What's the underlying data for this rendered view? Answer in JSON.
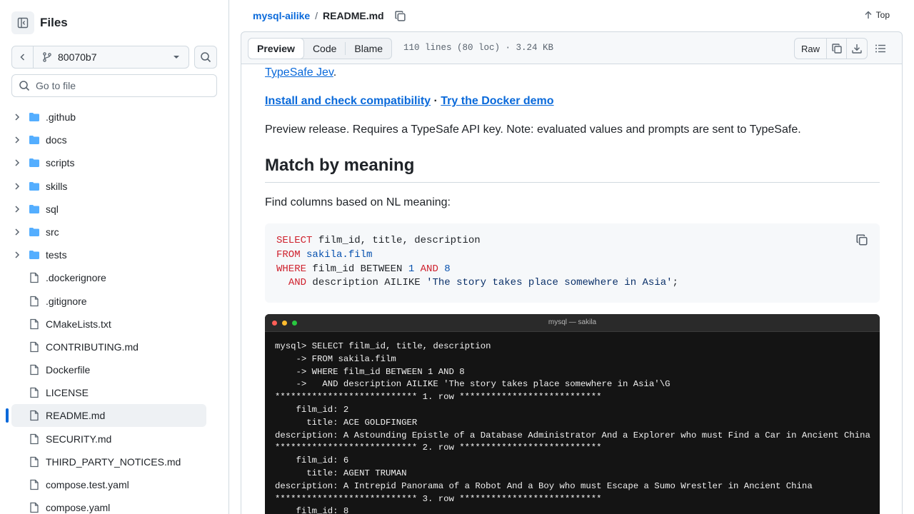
{
  "sidebar": {
    "title": "Files",
    "branch": "80070b7",
    "goto_placeholder": "Go to file",
    "items": [
      {
        "name": ".github",
        "type": "folder"
      },
      {
        "name": "docs",
        "type": "folder"
      },
      {
        "name": "scripts",
        "type": "folder"
      },
      {
        "name": "skills",
        "type": "folder"
      },
      {
        "name": "sql",
        "type": "folder"
      },
      {
        "name": "src",
        "type": "folder"
      },
      {
        "name": "tests",
        "type": "folder"
      },
      {
        "name": ".dockerignore",
        "type": "file"
      },
      {
        "name": ".gitignore",
        "type": "file"
      },
      {
        "name": "CMakeLists.txt",
        "type": "file"
      },
      {
        "name": "CONTRIBUTING.md",
        "type": "file"
      },
      {
        "name": "Dockerfile",
        "type": "file"
      },
      {
        "name": "LICENSE",
        "type": "file"
      },
      {
        "name": "README.md",
        "type": "file",
        "active": true
      },
      {
        "name": "SECURITY.md",
        "type": "file"
      },
      {
        "name": "THIRD_PARTY_NOTICES.md",
        "type": "file"
      },
      {
        "name": "compose.test.yaml",
        "type": "file"
      },
      {
        "name": "compose.yaml",
        "type": "file"
      }
    ]
  },
  "header": {
    "repo": "mysql-ailike",
    "separator": "/",
    "file": "README.md",
    "top_label": "Top"
  },
  "filebar": {
    "tabs": [
      "Preview",
      "Code",
      "Blame"
    ],
    "meta": "110 lines (80 loc) · 3.24 KB",
    "raw_label": "Raw"
  },
  "readme": {
    "link_typesafe": "TypeSafe Jev",
    "period": ".",
    "link_install": "Install and check compatibility",
    "bullet": " · ",
    "link_docker": "Try the Docker demo",
    "preview_note": "Preview release. Requires a TypeSafe API key. Note: evaluated values and prompts are sent to TypeSafe.",
    "heading": "Match by meaning",
    "find_text": "Find columns based on NL meaning:",
    "code": {
      "l1_kw": "SELECT",
      "l1_rest": " film_id, title, description",
      "l2_kw": "FROM",
      "l2_tbl": " sakila.film",
      "l3_kw": "WHERE",
      "l3_a": " film_id BETWEEN ",
      "l3_n1": "1",
      "l3_and": " AND ",
      "l3_n2": "8",
      "l4_indent": "  ",
      "l4_kw": "AND",
      "l4_a": " description AILIKE ",
      "l4_str": "'The story takes place somewhere in Asia'",
      "l4_end": ";"
    },
    "terminal": {
      "title": "mysql — sakila",
      "lines": [
        "mysql> SELECT film_id, title, description",
        "    -> FROM sakila.film",
        "    -> WHERE film_id BETWEEN 1 AND 8",
        "    ->   AND description AILIKE 'The story takes place somewhere in Asia'\\G",
        "*************************** 1. row ***************************",
        "    film_id: 2",
        "      title: ACE GOLDFINGER",
        "description: A Astounding Epistle of a Database Administrator And a Explorer who must Find a Car in Ancient China",
        "*************************** 2. row ***************************",
        "    film_id: 6",
        "      title: AGENT TRUMAN",
        "description: A Intrepid Panorama of a Robot And a Boy who must Escape a Sumo Wrestler in Ancient China",
        "*************************** 3. row ***************************",
        "    film_id: 8"
      ]
    }
  },
  "colors": {
    "accent": "#0969da",
    "folder": "#54aeff",
    "border": "#d1d9e0",
    "terminal_bg": "#141414",
    "light_red": "#ff5f57",
    "light_yellow": "#febc2e",
    "light_green": "#28c840"
  }
}
